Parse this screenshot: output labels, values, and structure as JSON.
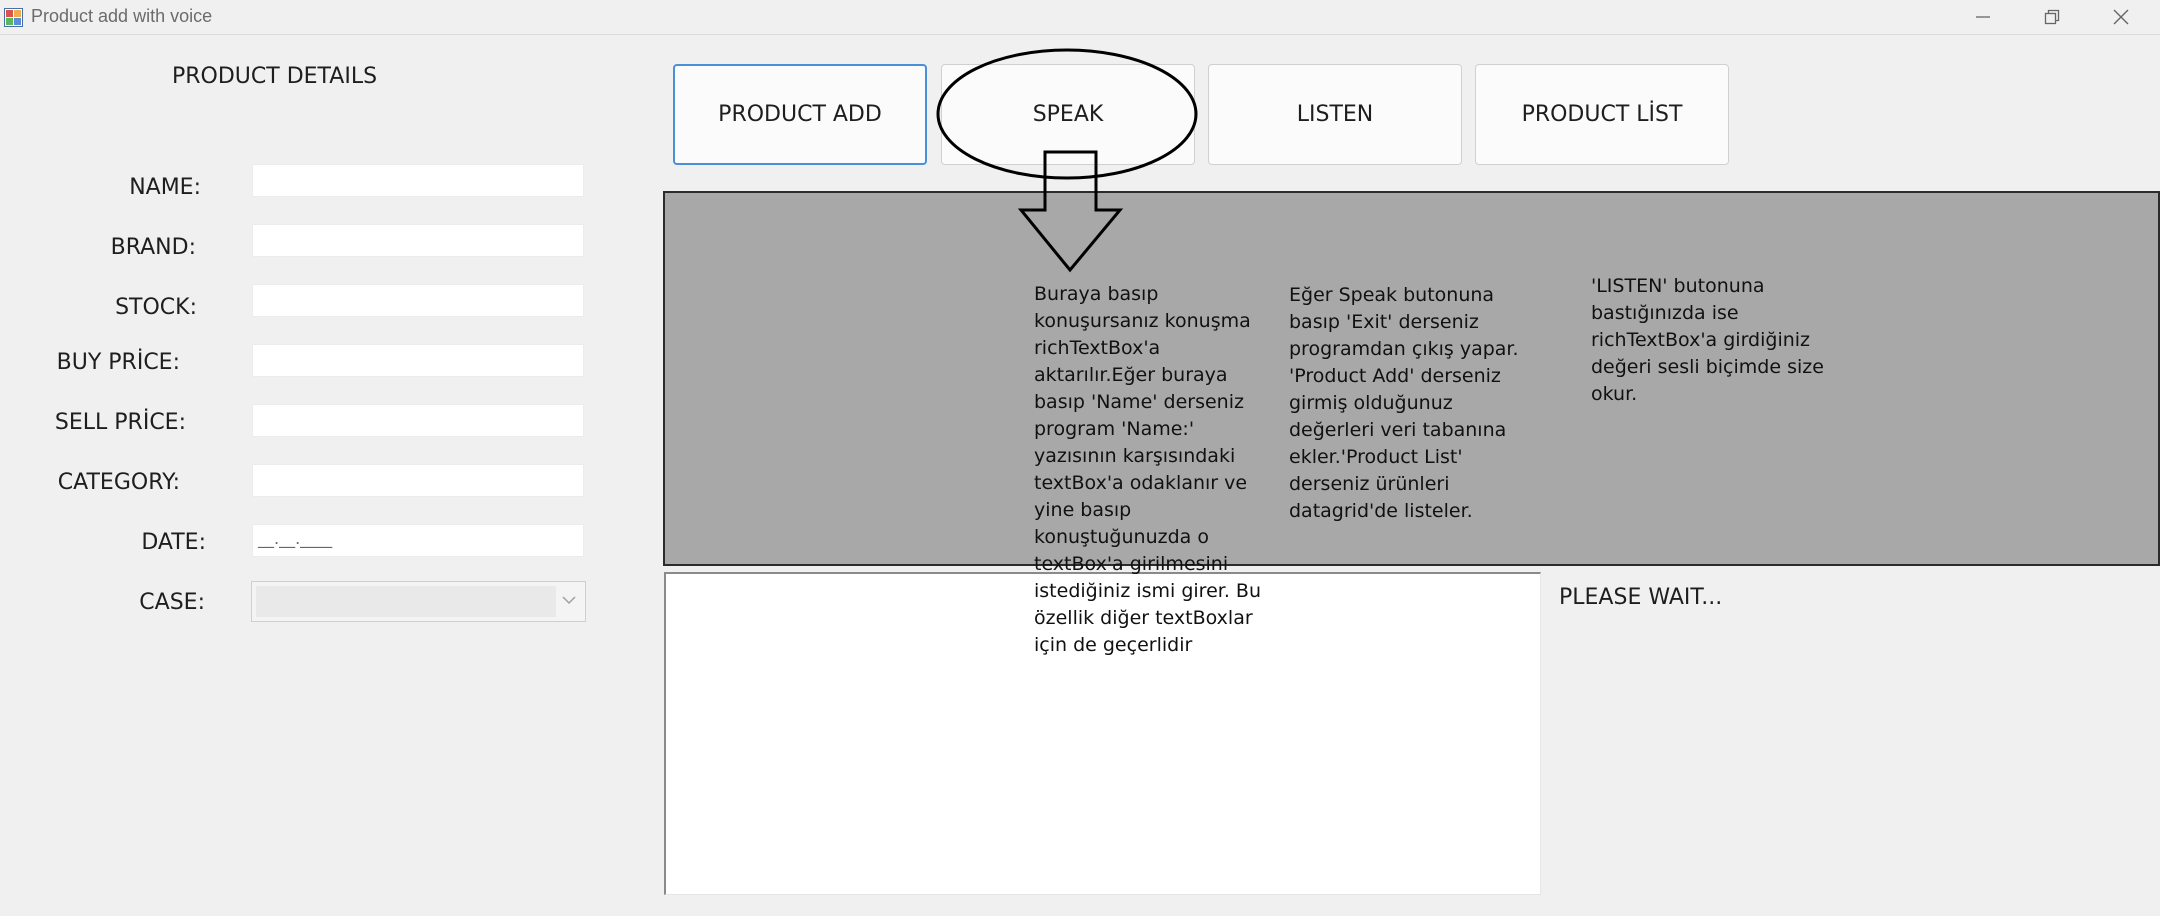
{
  "window": {
    "title": "Product add with voice",
    "controls": [
      "minimize-icon",
      "maximize-icon",
      "close-icon"
    ]
  },
  "form": {
    "section_title": "PRODUCT DETAILS",
    "fields": [
      {
        "label": "NAME:",
        "value": ""
      },
      {
        "label": "BRAND:",
        "value": ""
      },
      {
        "label": "STOCK:",
        "value": ""
      },
      {
        "label": "BUY PRİCE:",
        "value": ""
      },
      {
        "label": "SELL PRİCE:",
        "value": ""
      },
      {
        "label": "CATEGORY:",
        "value": ""
      },
      {
        "label": "DATE:",
        "value": "__.__.____"
      },
      {
        "label": "CASE:",
        "value": ""
      }
    ]
  },
  "toolbar": {
    "product_add": "PRODUCT ADD",
    "speak": "SPEAK",
    "listen": "LISTEN",
    "product_list": "PRODUCT LİST"
  },
  "notes": {
    "speak": "Buraya basıp\nkonuşursanız konuşma\nrichTextBox'a\naktarılır.Eğer buraya\nbasıp 'Name' derseniz\nprogram 'Name:'\nyazısının karşısındaki\ntextBox'a odaklanır ve\nyine basıp\nkonuştuğunuzda o\ntextBox'a girilmesini\nistediğiniz ismi girer. Bu\nözellik diğer textBoxlar\niçin de geçerlidir",
    "exit": "Eğer Speak butonuna\nbasıp 'Exit' derseniz\nprogramdan çıkış yapar.\n'Product Add' derseniz\ngirmiş olduğunuz\ndeğerleri veri tabanına\nekler.'Product List'\nderseniz ürünleri\ndatagrid'de listeler.",
    "listen": "'LISTEN' butonuna\nbastığınızda ise\nrichTextBox'a girdiğiniz\ndeğeri sesli biçimde size\nokur."
  },
  "rich_text": {
    "value": ""
  },
  "status": {
    "text": "PLEASE WAIT..."
  },
  "colors": {
    "panel_gray": "#a8a8a8",
    "window_bg": "#f0f0f0",
    "focus_border": "#4a90d9"
  }
}
